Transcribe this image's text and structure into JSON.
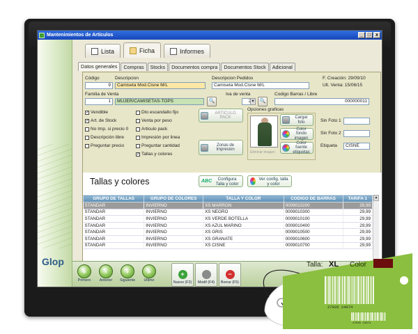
{
  "window": {
    "title": "Mantenimientos de Artículos",
    "controls": [
      "_",
      "□",
      "x"
    ]
  },
  "top_tabs": [
    {
      "label": "Lista",
      "active": false
    },
    {
      "label": "Ficha",
      "active": true
    },
    {
      "label": "Informes",
      "active": false
    }
  ],
  "sub_tabs": [
    {
      "label": "Datos generales",
      "active": true
    },
    {
      "label": "Compras",
      "active": false
    },
    {
      "label": "Stocks",
      "active": false
    },
    {
      "label": "Documentos compra",
      "active": false
    },
    {
      "label": "Documentos Stock",
      "active": false
    },
    {
      "label": "Adicional",
      "active": false
    }
  ],
  "form": {
    "codigo_label": "Código",
    "codigo_value": "9",
    "descripcion_label": "Descripcion",
    "descripcion_value": "Camiseta Mod.Cisne M/L",
    "descripcion_pedidos_label": "Descripcion Pedidos",
    "descripcion_pedidos_value": "Camiseta Mod.Cisne M/L",
    "f_creacion": "F. Creación: 29/09/10",
    "ult_venta": "Ult. Venta:  15/06/15",
    "familia_label": "Familia de Venta",
    "familia_code": "1",
    "familia_value": "MUJER/CAMISETAS-TOPS",
    "iva_label": "Iva de venta",
    "iva_value": "21",
    "codigo_barras_label": "Codigo Barras / Libre",
    "codigo_barras_value": "000000011",
    "articulo_pack_label": "ARTICULO PACK",
    "zonas_label": "Zonas de Impresion",
    "opciones_label": "Opciones graficas",
    "eliminar_imagen": "Eliminar imagen",
    "cargar_foto": "Cargar foto",
    "color_fondo": "Color fondo imagen",
    "color_fuente": "Color fuente etiquetas",
    "sin_foto_1": "Sin Foto 1",
    "sin_foto_2": "Sin Foto 2",
    "etiqueta_label": "Etiqueta",
    "etiqueta_value": "CISNE"
  },
  "checkboxes_left": [
    {
      "label": "Vendible",
      "checked": true
    },
    {
      "label": "Art. de Stock",
      "checked": true
    },
    {
      "label": "No Imp. si precio 0",
      "checked": false
    },
    {
      "label": "Descripción libre",
      "checked": false
    },
    {
      "label": "Preguntar precio",
      "checked": false
    }
  ],
  "checkboxes_right": [
    {
      "label": "Dto escandallo fijo",
      "checked": false
    },
    {
      "label": "Venta por peso",
      "checked": false
    },
    {
      "label": "Articulo pack",
      "checked": false
    },
    {
      "label": "Impresión por linea",
      "checked": false
    },
    {
      "label": "Preguntar cantidad",
      "checked": false
    },
    {
      "label": "Tallas y colores",
      "checked": true
    }
  ],
  "tallas": {
    "title": "Tallas y colores",
    "config_btn": "Configura Talla y color",
    "ver_config_btn": "Ver config. talla y color",
    "abc": "ABC",
    "columns": [
      "GRUPO DE TALLAS",
      "GRUPO DE COLORES",
      "TALLA Y COLOR",
      "CODIGO DE BARRAS",
      "TARIFA 1"
    ],
    "rows": [
      [
        "STANDAR",
        "INVIERNO",
        "XS MARRON",
        "0009010200",
        "29,99"
      ],
      [
        "STANDAR",
        "INVIERNO",
        "XS NEGRO",
        "0009010300",
        "29,99"
      ],
      [
        "STANDAR",
        "INVIERNO",
        "XS VERDE BOTELLA",
        "0009010100",
        "29,99"
      ],
      [
        "STANDAR",
        "INVIERNO",
        "XS AZUL MARINO",
        "0009010400",
        "29,99"
      ],
      [
        "STANDAR",
        "INVIERNO",
        "XS GRIS",
        "0009010500",
        "29,99"
      ],
      [
        "STANDAR",
        "INVIERNO",
        "XS GRANATE",
        "0009010600",
        "29,99"
      ],
      [
        "STANDAR",
        "INVIERNO",
        "XS CISNE",
        "0009010700",
        "29,99"
      ]
    ]
  },
  "brand": "Glop",
  "nav": [
    {
      "label": "Primero",
      "glyph": "«"
    },
    {
      "label": "Anterior",
      "glyph": "‹"
    },
    {
      "label": "Siguiente",
      "glyph": "›"
    },
    {
      "label": "Ultimo",
      "glyph": "»"
    }
  ],
  "actions": [
    {
      "label": "Nuevo (F3)",
      "glyph": "+",
      "color": "#3aa23a"
    },
    {
      "label": "Modif (F4)",
      "glyph": "",
      "color": "#8a8a8a"
    },
    {
      "label": "Borrar (F5)",
      "glyph": "−",
      "color": "#d23030"
    }
  ],
  "tag": {
    "talla_label": "Talla:",
    "talla_value": "XL",
    "color_label": "Color",
    "barcode_text": "27035 24074",
    "tag_color": "#8bbf3f",
    "swatch_color": "#6b0d0d"
  }
}
